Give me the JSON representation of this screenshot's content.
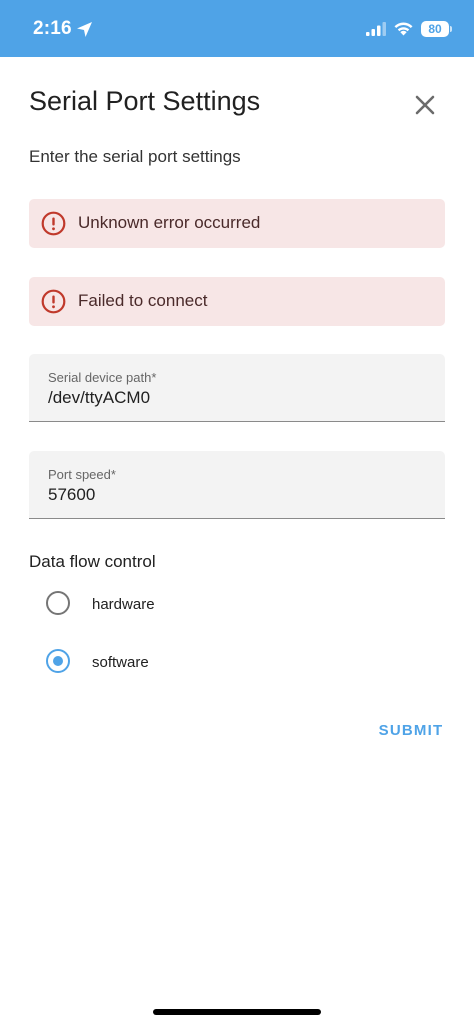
{
  "status_bar": {
    "time": "2:16",
    "battery_level": "80",
    "background_color": "#4fa3e7"
  },
  "dialog": {
    "title": "Serial Port Settings",
    "subtitle": "Enter the serial port settings",
    "close_icon": "close-icon"
  },
  "alerts": [
    {
      "message": "Unknown error occurred",
      "icon": "error-outline-icon",
      "color": "#c62828"
    },
    {
      "message": "Failed to connect",
      "icon": "error-outline-icon",
      "color": "#c62828"
    }
  ],
  "fields": {
    "device_path": {
      "label": "Serial device path*",
      "value": "/dev/ttyACM0"
    },
    "port_speed": {
      "label": "Port speed*",
      "value": "57600"
    }
  },
  "flow_control": {
    "label": "Data flow control",
    "options": [
      {
        "label": "hardware",
        "selected": false
      },
      {
        "label": "software",
        "selected": true
      }
    ]
  },
  "actions": {
    "submit_label": "SUBMIT",
    "accent_color": "#4fa3e7"
  }
}
